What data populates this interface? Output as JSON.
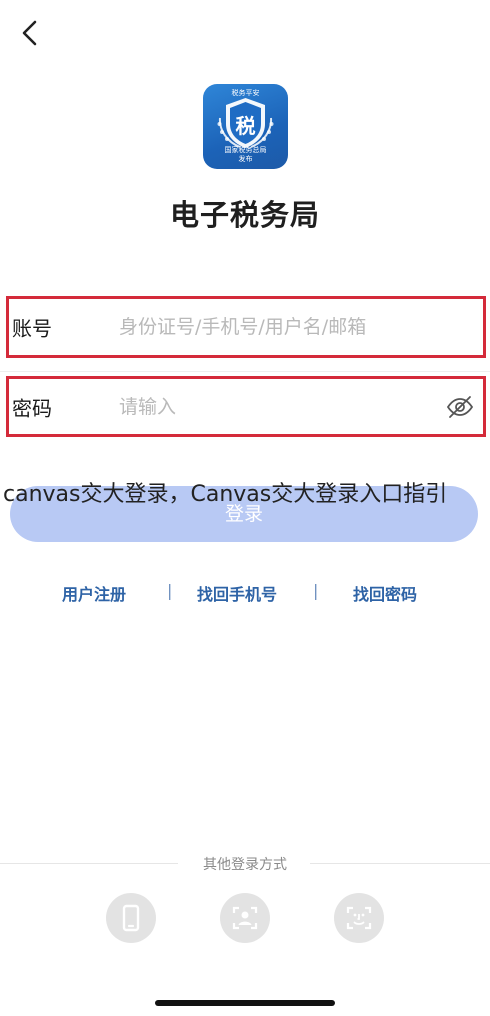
{
  "header": {
    "back_icon": "chevron-left-icon"
  },
  "app": {
    "logo_top_text": "税务平安",
    "logo_char": "税",
    "logo_bottom_line1": "国家税务总局",
    "logo_bottom_line2": "发布",
    "title": "电子税务局"
  },
  "form": {
    "account_label": "账号",
    "account_placeholder": "身份证号/手机号/用户名/邮箱",
    "password_label": "密码",
    "password_placeholder": "请输入",
    "password_visibility_icon": "eye-off-icon",
    "login_label": "登录"
  },
  "overlay": {
    "text": "canvas交大登录，Canvas交大登录入口指引"
  },
  "links": {
    "register": "用户注册",
    "separator": "|",
    "recover_phone": "找回手机号",
    "recover_password": "找回密码"
  },
  "other_login": {
    "title": "其他登录方式",
    "methods": [
      {
        "icon": "phone-icon"
      },
      {
        "icon": "face-card-icon"
      },
      {
        "icon": "face-scan-icon"
      }
    ]
  },
  "colors": {
    "highlight_border": "#d42a3a",
    "login_button": "#b8c9f4",
    "link": "#2e63a6",
    "logo_blue": "#1c63b8"
  }
}
